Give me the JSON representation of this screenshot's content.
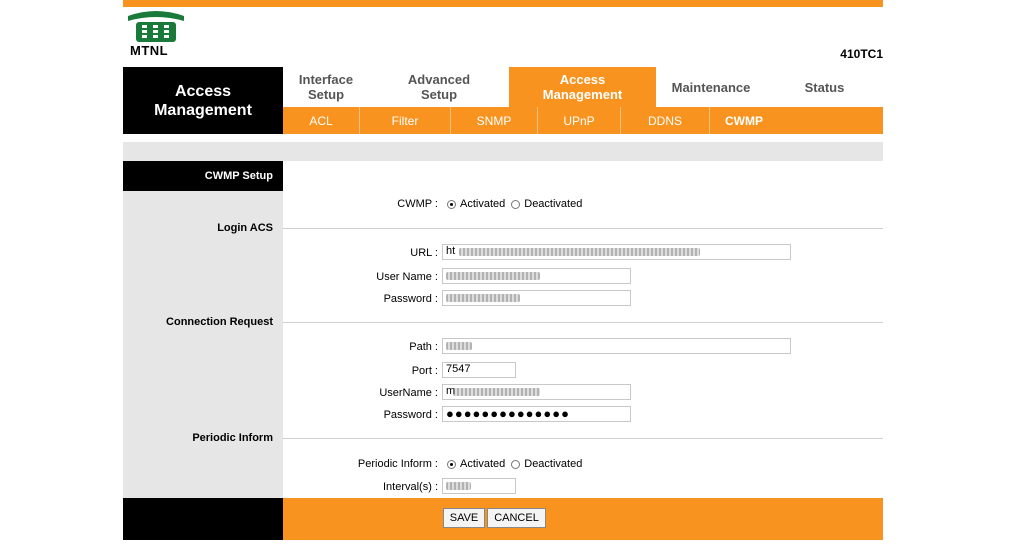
{
  "brand": {
    "name": "MTNL",
    "model": "410TC1"
  },
  "header": {
    "section_title": "Access Management"
  },
  "tabs": [
    {
      "label": "Interface Setup",
      "active": false
    },
    {
      "label": "Advanced Setup",
      "active": false
    },
    {
      "label": "Access Management",
      "active": true
    },
    {
      "label": "Maintenance",
      "active": false
    },
    {
      "label": "Status",
      "active": false
    }
  ],
  "subtabs": [
    {
      "label": "ACL",
      "active": false
    },
    {
      "label": "Filter",
      "active": false
    },
    {
      "label": "SNMP",
      "active": false
    },
    {
      "label": "UPnP",
      "active": false
    },
    {
      "label": "DDNS",
      "active": false
    },
    {
      "label": "CWMP",
      "active": true
    }
  ],
  "form": {
    "panel_title": "CWMP Setup",
    "cwmp": {
      "label": "CWMP :",
      "activated": "Activated",
      "deactivated": "Deactivated",
      "selected": "Activated"
    },
    "login_acs": {
      "title": "Login ACS",
      "url_label": "URL :",
      "url_value": "ht",
      "username_label": "User Name :",
      "username_value": "",
      "password_label": "Password :",
      "password_value": ""
    },
    "connection_request": {
      "title": "Connection Request",
      "path_label": "Path :",
      "path_value": "",
      "port_label": "Port :",
      "port_value": "7547",
      "username_label": "UserName :",
      "username_value": "m",
      "password_label": "Password :",
      "password_value": "●●●●●●●●●●●●●●"
    },
    "periodic_inform": {
      "title": "Periodic Inform",
      "label": "Periodic Inform :",
      "activated": "Activated",
      "deactivated": "Deactivated",
      "selected": "Activated",
      "interval_label": "Interval(s) :",
      "interval_value": ""
    }
  },
  "buttons": {
    "save": "SAVE",
    "cancel": "CANCEL"
  },
  "colors": {
    "accent": "#f7931e",
    "panel_gray": "#e6e6e6",
    "black": "#000000"
  }
}
